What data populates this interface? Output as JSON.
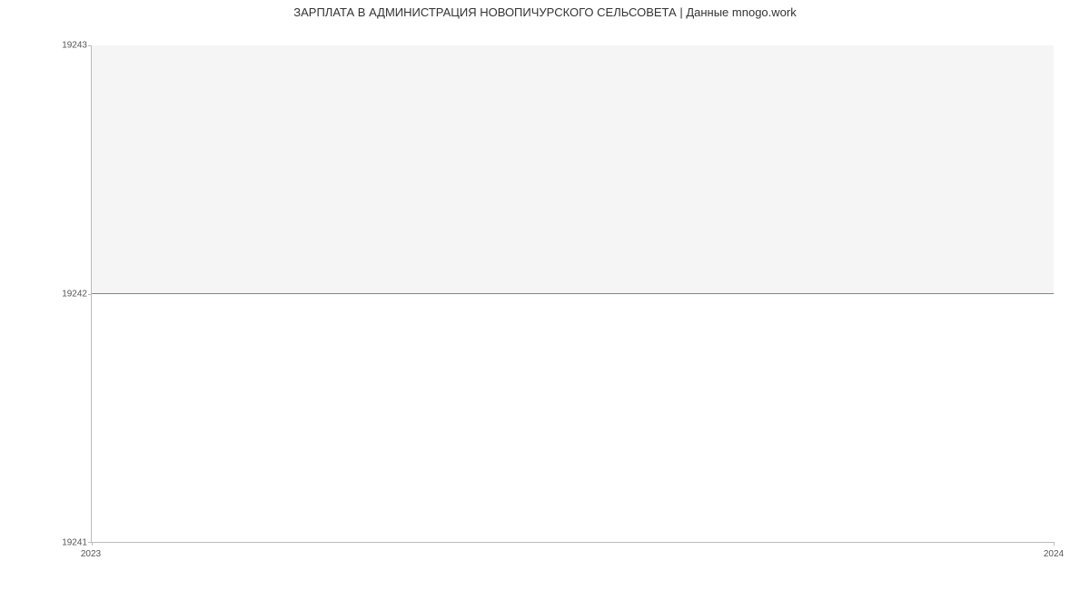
{
  "chart_data": {
    "type": "line",
    "title": "ЗАРПЛАТА В АДМИНИСТРАЦИЯ НОВОПИЧУРСКОГО СЕЛЬСОВЕТА | Данные mnogo.work",
    "xlabel": "",
    "ylabel": "",
    "x": [
      2023,
      2024
    ],
    "values": [
      19242,
      19242
    ],
    "ylim": [
      19241,
      19243
    ],
    "xlim": [
      2023,
      2024
    ],
    "yticks": [
      19241,
      19242,
      19243
    ],
    "xticks": [
      2023,
      2024
    ],
    "line_color": "#4a90d9"
  },
  "ticks": {
    "y0": "19241",
    "y1": "19242",
    "y2": "19243",
    "x0": "2023",
    "x1": "2024"
  }
}
